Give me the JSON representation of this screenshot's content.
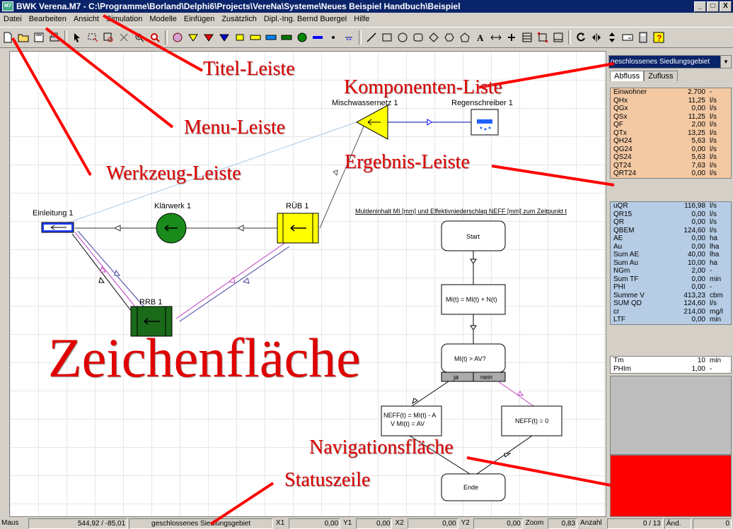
{
  "window": {
    "title": "BWK Verena.M7 - C:\\Programme\\Borland\\Delphi6\\Projects\\VereNa\\Systeme\\Neues Beispiel Handbuch\\Beispiel",
    "icon_label": "M7",
    "minimize": "_",
    "maximize": "×",
    "restore": "□",
    "close": "X"
  },
  "menu": [
    "Datei",
    "Bearbeiten",
    "Ansicht",
    "Simulation",
    "Modelle",
    "Einfügen",
    "Zusätzlich",
    "Dipl.-Ing. Bernd Buergel",
    "Hilfe"
  ],
  "canvas": {
    "nodes": {
      "einleitung": "Einleitung 1",
      "klaerwerk": "Klärwerk 1",
      "rueb": "RÜB 1",
      "rrb": "RRB 1",
      "misch": "Mischwassernetz 1",
      "regen": "Regenschreiber 1"
    },
    "flow_title": "Muldeninhalt MI [mm]  und Effektivniederschlag NEFF [mm] zum Zeitpunkt t",
    "flow": {
      "start": "Start",
      "step1": "MI(t) = MI(t) + N(t)",
      "decision": "MI(t) > AV?",
      "yes": "ja",
      "no": "nein",
      "left1": "NEFF(t) = MI(t) - A",
      "left2": "V MI(t)  = AV",
      "right": "NEFF(t) = 0",
      "end": "Ende"
    }
  },
  "annotations": {
    "titel": "Titel-Leiste",
    "menu": "Menu-Leiste",
    "werkzeug": "Werkzeug-Leiste",
    "komponenten": "Komponenten-Liste",
    "ergebnis": "Ergebnis-Leiste",
    "zeichen": "Zeichenfläche",
    "navigation": "Navigationsfläche",
    "status": "Statuszeile"
  },
  "rightpanel": {
    "combo_value": "geschlossenes Siedlungsgebiet",
    "tabs": [
      "Abfluss",
      "Zufluss"
    ],
    "section1": [
      [
        "Einwohner",
        "2.700",
        "-"
      ],
      [
        "QHx",
        "11,25",
        "l/s"
      ],
      [
        "QGx",
        "0,00",
        "l/s"
      ],
      [
        "QSx",
        "11,25",
        "l/s"
      ],
      [
        "QF",
        "2,00",
        "l/s"
      ],
      [
        "QTx",
        "13,25",
        "l/s"
      ],
      [
        "QH24",
        "5,63",
        "l/s"
      ],
      [
        "QG24",
        "0,00",
        "l/s"
      ],
      [
        "QS24",
        "5,63",
        "l/s"
      ],
      [
        "QT24",
        "7,63",
        "l/s"
      ],
      [
        "QRT24",
        "0,00",
        "l/s"
      ]
    ],
    "section2": [
      [
        "uQR",
        "116,98",
        "l/s"
      ],
      [
        "QR15",
        "0,00",
        "l/s"
      ],
      [
        "QR",
        "0,00",
        "l/s"
      ],
      [
        "QBEM",
        "124,60",
        "l/s"
      ],
      [
        "AE",
        "0,00",
        "ha"
      ],
      [
        "Au",
        "0,00",
        "lha"
      ],
      [
        "Sum AE",
        "40,00",
        "lha"
      ],
      [
        "Sum Au",
        "10,00",
        "ha"
      ],
      [
        "NGm",
        "2,00",
        "-"
      ],
      [
        "Sum TF",
        "0,00",
        "min"
      ],
      [
        "PHI",
        "0,00",
        "-"
      ],
      [
        "Summe V",
        "413,23",
        "cbm"
      ],
      [
        "SUM QD",
        "124,60",
        "l/s"
      ],
      [
        "cr",
        "214,00",
        "mg/l"
      ],
      [
        "LTF",
        "0,00",
        "min"
      ]
    ],
    "section3": [
      [
        "Tm",
        "10",
        "min"
      ],
      [
        "PHIm",
        "1,00",
        "-"
      ]
    ]
  },
  "status": {
    "maus_label": "Maus",
    "maus_value": "544,92 / -85,01",
    "gebiet": "geschlossenes Siedlungsgebiet",
    "x1_label": "X1",
    "x1": "0,00",
    "y1_label": "Y1",
    "y1": "0,00",
    "x2_label": "X2",
    "x2": "0,00",
    "y2_label": "Y2",
    "y2": "0,00",
    "zoom_label": "Zoom",
    "zoom": "0,83",
    "anzahl_label": "Anzahl",
    "anzahl": "0 / 13",
    "aend_label": "Änd.",
    "aend": "0"
  },
  "colors": {
    "red_accent": "#ff0000",
    "title_bg": "#0a246a",
    "sec1": "#f3c9a4",
    "sec2": "#b7cde6"
  }
}
